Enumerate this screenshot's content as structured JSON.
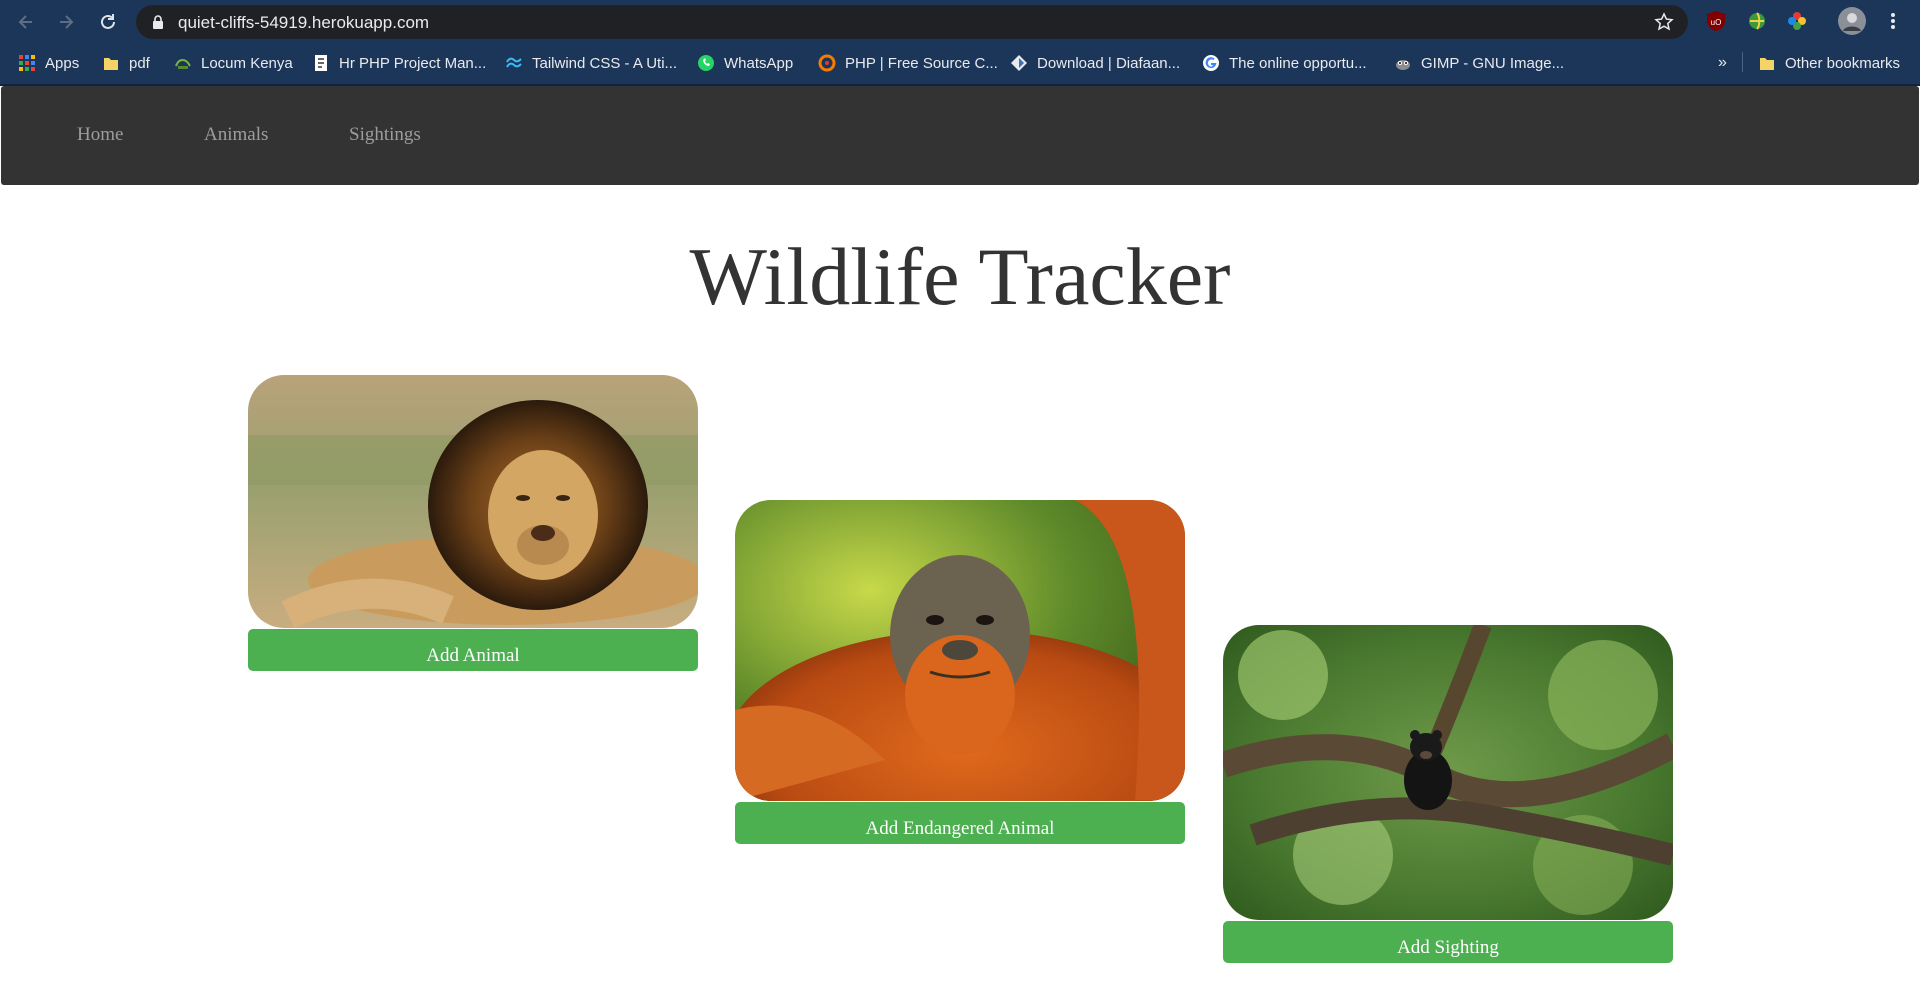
{
  "browser": {
    "url": "quiet-cliffs-54919.herokuapp.com",
    "bookmarks": [
      "Apps",
      "pdf",
      "Locum Kenya",
      "Hr PHP Project Man...",
      "Tailwind CSS - A Uti...",
      "WhatsApp",
      "PHP | Free Source C...",
      "Download | Diafaan...",
      "The online opportu...",
      "GIMP - GNU Image..."
    ],
    "overflow_label": "»",
    "other_bookmarks": "Other bookmarks"
  },
  "nav": {
    "items": [
      "Home",
      "Animals",
      "Sightings"
    ],
    "bg": "#333333",
    "text_color": "#9d9d9d"
  },
  "page": {
    "title": "Wildlife Tracker"
  },
  "cards": [
    {
      "image": "lion-photo",
      "button": "Add Animal"
    },
    {
      "image": "orangutan-photo",
      "button": "Add Endangered Animal"
    },
    {
      "image": "bear-in-tree-photo",
      "button": "Add Sighting"
    }
  ],
  "colors": {
    "button": "#4caf50",
    "chrome": "#1c3659"
  }
}
